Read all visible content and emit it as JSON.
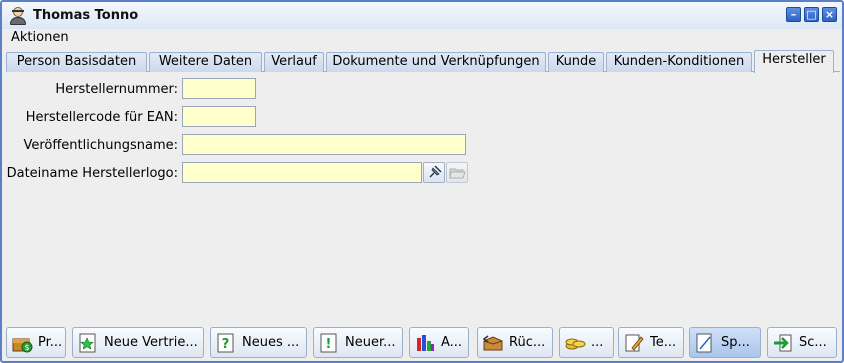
{
  "window": {
    "title": "Thomas Tonno"
  },
  "menu": {
    "items": [
      "Aktionen"
    ]
  },
  "tabs": [
    {
      "label": "Person Basisdaten"
    },
    {
      "label": "Weitere Daten"
    },
    {
      "label": "Verlauf"
    },
    {
      "label": "Dokumente und Verknüpfungen"
    },
    {
      "label": "Kunde"
    },
    {
      "label": "Kunden-Konditionen"
    },
    {
      "label": "Hersteller",
      "active": true
    }
  ],
  "form": {
    "herstellernummer": {
      "label": "Herstellernummer:",
      "value": ""
    },
    "herstellercode": {
      "label": "Herstellercode für EAN:",
      "value": ""
    },
    "veroeffentlichungsname": {
      "label": "Veröffentlichungsname:",
      "value": ""
    },
    "logo": {
      "label": "Dateiname Herstellerlogo:",
      "value": ""
    }
  },
  "bottom_buttons": [
    {
      "label": "Pr...",
      "icon": "money-chest-icon"
    },
    {
      "label": "Neue Vertrie...",
      "icon": "star-document-icon"
    },
    {
      "label": "Neues ...",
      "icon": "question-document-icon"
    },
    {
      "label": "Neuer...",
      "icon": "exclamation-document-icon"
    },
    {
      "label": "A...",
      "icon": "bar-chart-icon"
    },
    {
      "label": "Rüc...",
      "icon": "box-return-icon"
    },
    {
      "label": "...",
      "icon": "coins-icon"
    },
    {
      "label": "Te...",
      "icon": "notepad-pencil-icon"
    },
    {
      "label": "Sp...",
      "icon": "edit-document-icon",
      "active": true
    },
    {
      "label": "Sc...",
      "icon": "exit-arrow-icon"
    }
  ],
  "colors": {
    "input_bg": "#ffffcc",
    "title_accent": "#2d62c6",
    "window_border": "#5b80c9"
  }
}
